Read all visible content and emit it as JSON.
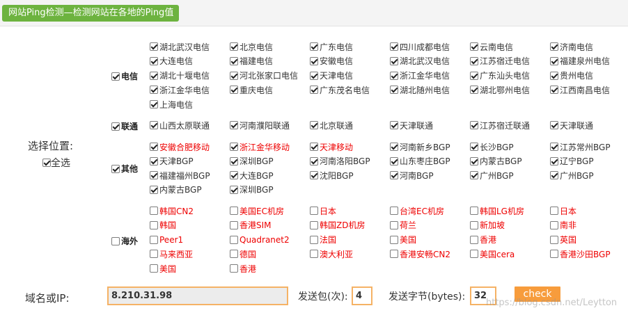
{
  "title": "网站Ping检测—检测网站在各地的Ping值",
  "location_label": "选择位置:",
  "select_all_label": "全选",
  "groups": {
    "telecom": "电信",
    "unicom": "联通",
    "other": "其他",
    "overseas": "海外"
  },
  "telecom_items": [
    "湖北武汉电信",
    "北京电信",
    "广东电信",
    "四川成都电信",
    "云南电信",
    "济南电信",
    "大连电信",
    "福建电信",
    "安徽电信",
    "湖北武汉电信",
    "江苏宿迁电信",
    "福建泉州电信",
    "湖北十堰电信",
    "河北张家口电信",
    "天津电信",
    "浙江金华电信",
    "广东汕头电信",
    "贵州电信",
    "浙江金华电信",
    "重庆电信",
    "广东茂名电信",
    "湖北随州电信",
    "湖北鄂州电信",
    "江西南昌电信",
    "上海电信"
  ],
  "unicom_items": [
    "山西太原联通",
    "河南濮阳联通",
    "北京联通",
    "天津联通",
    "江苏宿迁联通",
    "天津联通"
  ],
  "other_items": [
    "安徽合肥移动",
    "浙江金华移动",
    "天津移动",
    "河南新乡BGP",
    "长沙BGP",
    "江苏常州BGP",
    "天津BGP",
    "深圳BGP",
    "河南洛阳BGP",
    "山东枣庄BGP",
    "内蒙古BGP",
    "辽宁BGP",
    "福建福州BGP",
    "大连BGP",
    "沈阳BGP",
    "河南BGP",
    "广州BGP",
    "广州BGP",
    "内蒙古BGP",
    "深圳BGP"
  ],
  "overseas_items": [
    "韩国CN2",
    "美国EC机房",
    "日本",
    "台湾EC机房",
    "韩国LG机房",
    "日本",
    "韩国",
    "香港SIM",
    "韩国ZD机房",
    "荷兰",
    "新加坡",
    "南非",
    "Peer1",
    "Quadranet2",
    "法国",
    "美国",
    "香港",
    "英国",
    "马来西亚",
    "德国",
    "澳大利亚",
    "香港安畅CN2",
    "美国cera",
    "香港沙田BGP",
    "美国",
    "香港"
  ],
  "domain_label": "域名或IP:",
  "domain_value": "8.210.31.98",
  "packets_label": "发送包(次):",
  "packets_value": "4",
  "bytes_label": "发送字节(bytes):",
  "bytes_value": "32",
  "check_label": "check",
  "watermark": "https://blog.csdn.net/Leytton",
  "colors": {
    "title_bg": "#6db33f",
    "check_bg": "#f79c3c",
    "input_border": "#f5b265",
    "red_text": "#e00000"
  }
}
